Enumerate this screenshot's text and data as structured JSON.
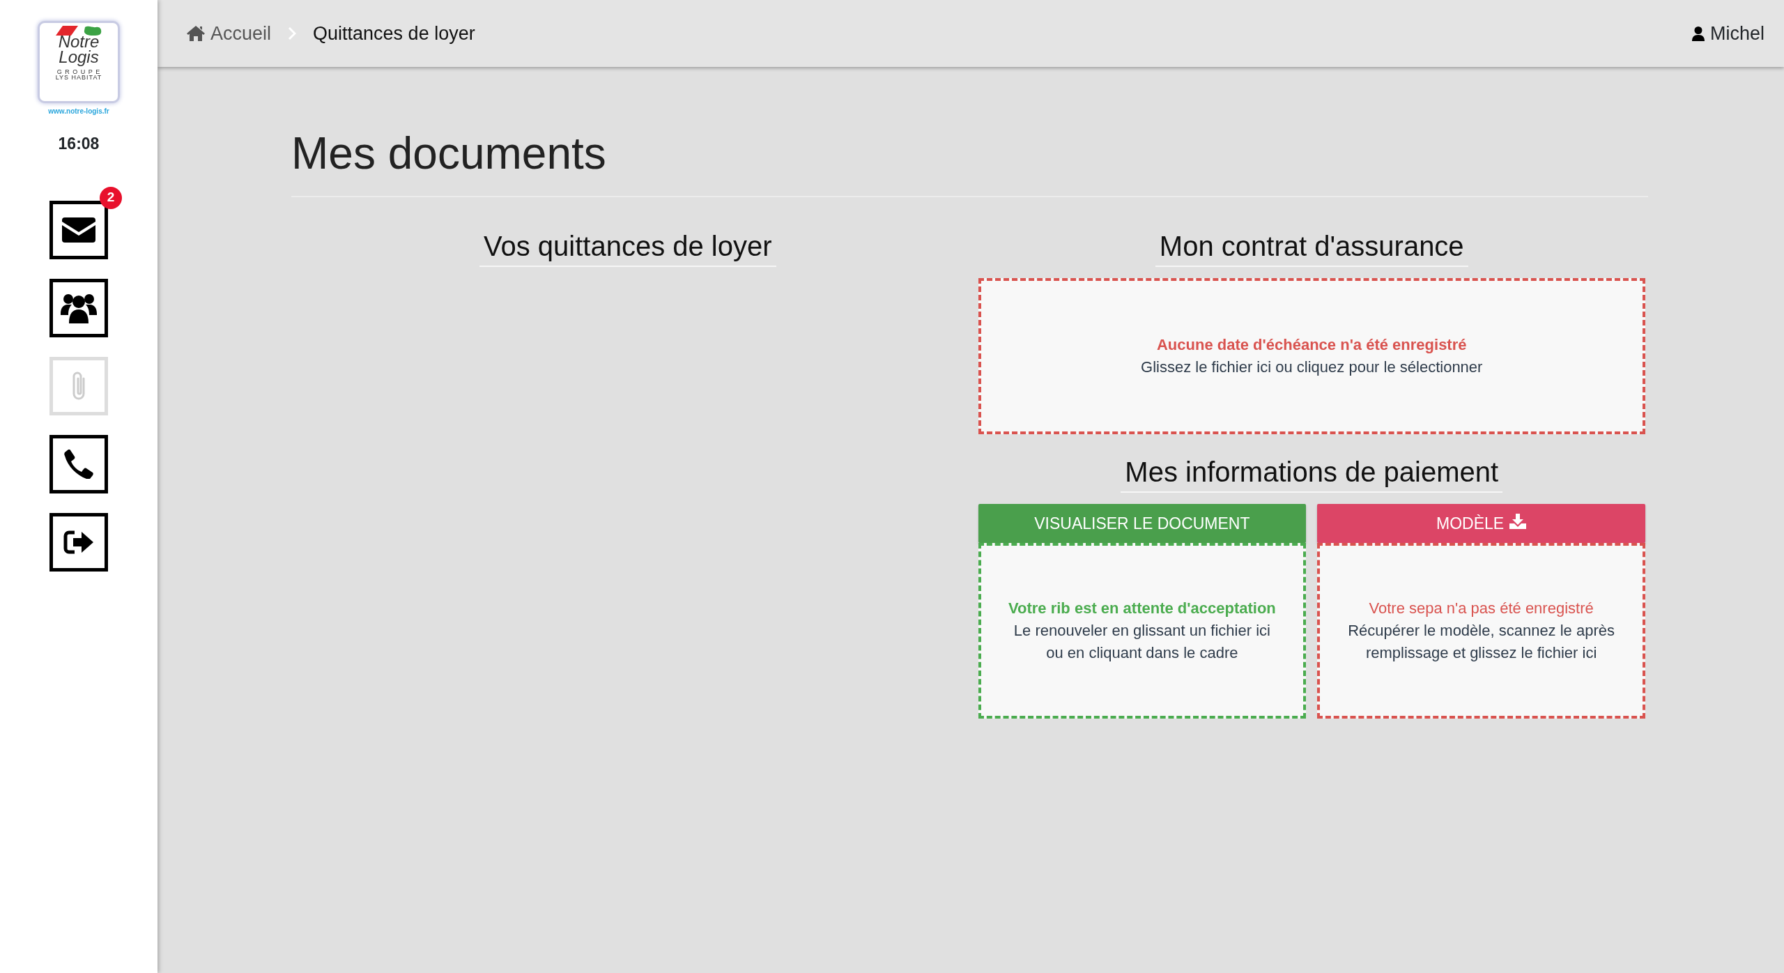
{
  "sidebar": {
    "logo": {
      "line1": "Notre",
      "line2": "Logis",
      "group": "G R O U P E",
      "brand": "LYS HABITAT"
    },
    "url": "www.notre-logis.fr",
    "time": "16:08",
    "items": [
      {
        "kind": "messages",
        "badge": "2",
        "disabled": false
      },
      {
        "kind": "contacts",
        "disabled": false
      },
      {
        "kind": "attachments",
        "disabled": true
      },
      {
        "kind": "phone",
        "disabled": false
      },
      {
        "kind": "logout",
        "disabled": false
      }
    ]
  },
  "breadcrumb": [
    {
      "kind": "home",
      "label": "Accueil",
      "current": false
    },
    {
      "kind": "page",
      "label": "Quittances de loyer",
      "current": true
    }
  ],
  "user": "Michel",
  "page_title": "Mes documents",
  "columns": [
    {
      "sections": [
        {
          "title": "Vos quittances de loyer"
        }
      ]
    },
    {
      "sections": [
        {
          "title": "Mon contrat d'assurance",
          "dropzones": [
            {
              "color": "#d9534f",
              "message": "Aucune date d'échéance n'a été enregistré",
              "message_bold": true,
              "hint": "Glissez le fichier ici ou cliquez pour le sélectionner"
            }
          ]
        },
        {
          "title": "Mes informations de paiement",
          "dropzones": [
            {
              "color": "#4bac4f",
              "message": "Votre rib est en attente d'acceptation",
              "message_bold": true,
              "hint": "Le renouveler en glissant un fichier ici ou en cliquant dans le cadre",
              "button": {
                "kind": "view",
                "label": "VISUALISER LE DOCUMENT"
              }
            },
            {
              "color": "#d9534f",
              "message": "Votre sepa n'a pas été enregistré",
              "message_bold": false,
              "hint": "Récupérer le modèle, scannez le après remplissage et glissez le fichier ici",
              "button": {
                "kind": "download",
                "label": "MODÈLE"
              }
            }
          ]
        }
      ]
    }
  ]
}
